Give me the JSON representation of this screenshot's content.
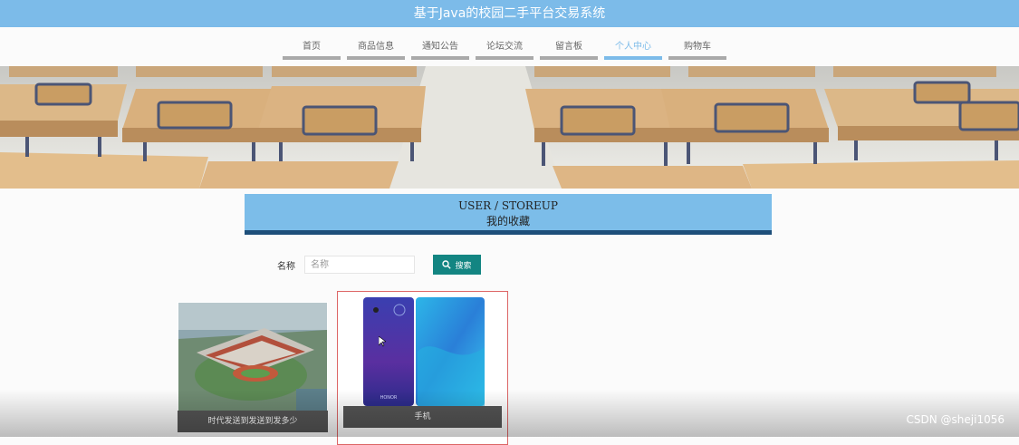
{
  "header": {
    "title": "基于Java的校园二手平台交易系统"
  },
  "nav": {
    "items": [
      {
        "label": "首页"
      },
      {
        "label": "商品信息"
      },
      {
        "label": "通知公告"
      },
      {
        "label": "论坛交流"
      },
      {
        "label": "留言板"
      },
      {
        "label": "个人中心",
        "active": true
      },
      {
        "label": "购物车"
      }
    ]
  },
  "section": {
    "title_en": "USER / STOREUP",
    "title_zh": "我的收藏"
  },
  "search": {
    "label": "名称",
    "placeholder": "名称",
    "button_label": "搜索",
    "button_icon": "search-icon"
  },
  "cards": [
    {
      "caption": "时代发送到发送到发多少",
      "image": "campus-building"
    },
    {
      "caption": "手机",
      "image": "smartphone"
    }
  ],
  "watermark": "CSDN @sheji1056",
  "colors": {
    "title_bar": "#7cbbe9",
    "nav_active": "#7cbbe9",
    "section_head": "#7cbde9",
    "section_border": "#1e4f7a",
    "search_button": "#138582"
  }
}
